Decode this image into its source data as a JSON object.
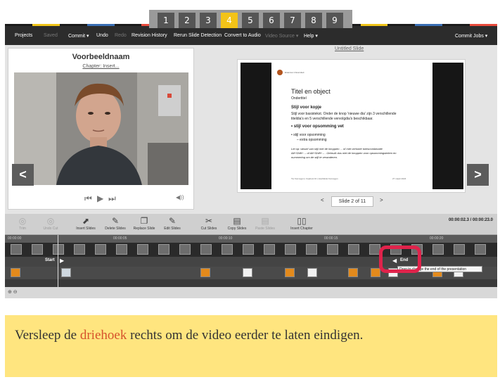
{
  "steps": [
    "1",
    "2",
    "3",
    "4",
    "5",
    "6",
    "7",
    "8",
    "9"
  ],
  "active_step": "4",
  "menu": {
    "projects": "Projects",
    "saved": "Saved",
    "commit": "Commit ▾",
    "undo": "Undo",
    "redo": "Redo",
    "revision_history": "Revision History",
    "rerun_slide_detection": "Rerun Slide Detection",
    "convert_to_audio": "Convert to Audio",
    "video_source": "Video Source ▾",
    "help": "Help ▾",
    "commit_jobs": "Commit Jobs ▾"
  },
  "video_panel": {
    "title": "Voorbeeldnaam",
    "chapter_link": "Chapter: Insert..."
  },
  "player_controls": {
    "prev": "⏮",
    "play": "▶",
    "next": "⏭",
    "volume": "◀))"
  },
  "slide_panel": {
    "title_link": "Untitled Slide",
    "counter": "Slide 2 of 11",
    "prev_arrow": "<",
    "next_arrow": ">"
  },
  "slide_content": {
    "heading": "Titel en object",
    "subheading": "Ondertitel",
    "kop": "Stijl voor kopje",
    "body": "Stijl voor basistekst. Onder de knop 'nieuwe dia' zijn 3 verschillende",
    "body2": "titeldia's en 5 verschillende vervolgdia's beschikbaar.",
    "bullet1": "• stijl voor opsomming vet",
    "bullet2": "• stijl voor opsomming",
    "bullet3": "– extra opsomming",
    "note": "Let op: wissel van stijl met de knoppen ... of met verkorte toetscombinatie",
    "note2": "Alt+Shift+→ of Alt+Shift+←. Gebruik dus niet de knoppen voor opsommingsteken en",
    "note3": "nummering om de stijl te veranderen.",
    "footer": "Tie Konnegen | Capitool 10 | Hoofdstuk Konnegen",
    "date": "27 maart 2024"
  },
  "nav_arrows": {
    "left": "<",
    "right": ">"
  },
  "toolbar": {
    "tools": [
      "Trim",
      "Undo Cut",
      "Insert Slides",
      "Delete Slides",
      "Replace Slide",
      "Edit Slides",
      "Cut Slides",
      "Copy Slides",
      "Paste Slides",
      "Insert Chapter"
    ],
    "timecode": "00:00:02.3 / 00:00:23.0"
  },
  "ruler_labels": [
    "00:00:00",
    "00:00:05",
    "00:00:10",
    "00:00:15",
    "00:00:20"
  ],
  "markers": {
    "start": "Start",
    "end": "End"
  },
  "tooltip": "Drag to change the end of the presentation",
  "instruction": {
    "before": "Versleep de ",
    "highlight": "driehoek",
    "after": " rechts om de video eerder te laten eindigen."
  },
  "colors": {
    "step_active": "#f3c318",
    "highlight_ring": "#e0234b",
    "instruction_bg": "#ffe57f",
    "highlight_word": "#d6532c"
  }
}
